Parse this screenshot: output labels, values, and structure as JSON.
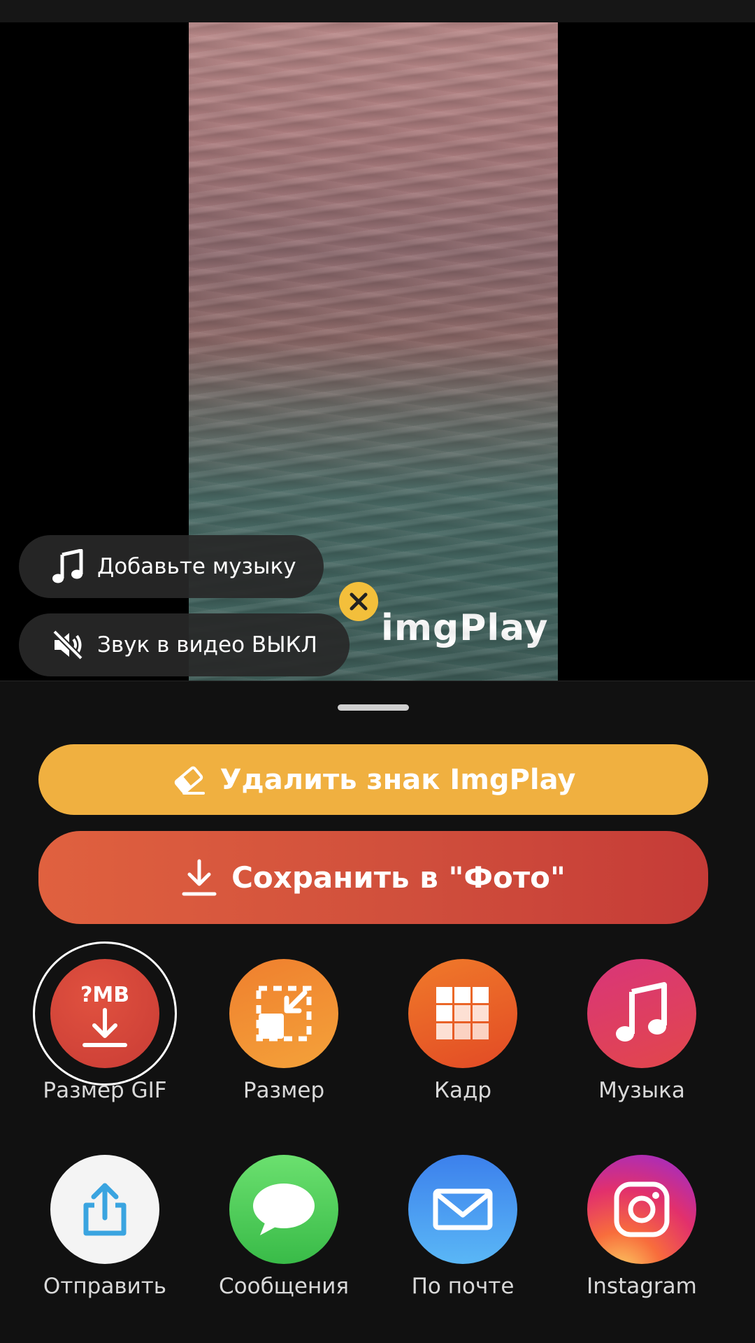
{
  "preview": {
    "watermark_text": "imgPlay",
    "add_music_label": "Добавьте музыку",
    "video_sound_label": "Звук в видео ВЫКЛ"
  },
  "actions": {
    "remove_watermark_label": "Удалить знак ImgPlay",
    "save_to_photos_label": "Сохранить в \"Фото\""
  },
  "tools": [
    {
      "label": "Размер GIF",
      "icon": "gif-size-download-icon",
      "badge": "?MB",
      "color": "#d7473b"
    },
    {
      "label": "Размер",
      "icon": "resize-icon",
      "color": "#ee8c33"
    },
    {
      "label": "Кадр",
      "icon": "frame-grid-icon",
      "color": "#e65a2b"
    },
    {
      "label": "Музыка",
      "icon": "music-note-icon",
      "color": "#df3a63"
    }
  ],
  "share": [
    {
      "label": "Отправить",
      "icon": "share-icon"
    },
    {
      "label": "Сообщения",
      "icon": "messages-icon"
    },
    {
      "label": "По почте",
      "icon": "mail-icon"
    },
    {
      "label": "Instagram",
      "icon": "instagram-icon"
    }
  ],
  "colors": {
    "watermark_button": "#f0b040",
    "save_button_start": "#e0613f",
    "save_button_end": "#c53b37"
  }
}
